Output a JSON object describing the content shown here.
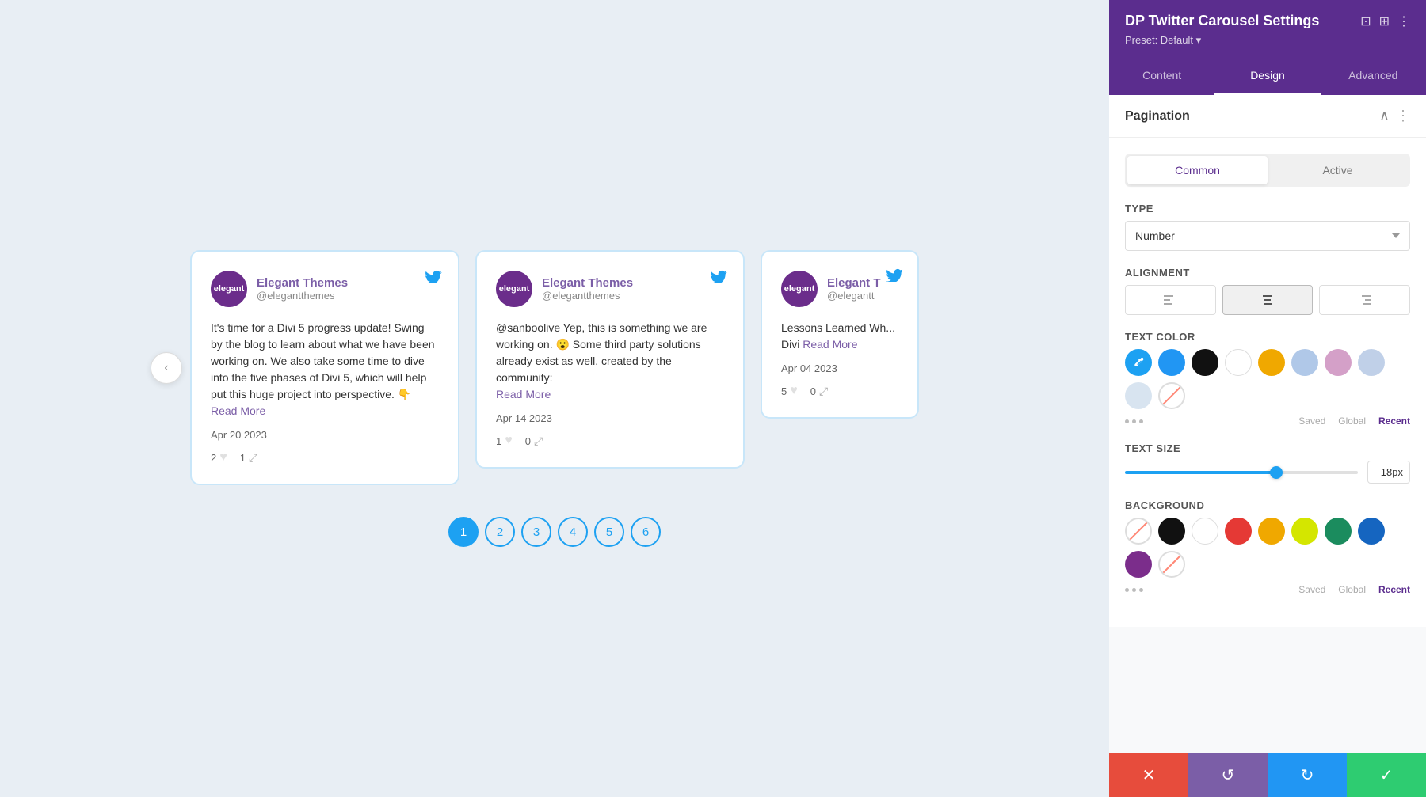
{
  "panel": {
    "title": "DP Twitter Carousel Settings",
    "preset_label": "Preset: Default",
    "preset_arrow": "▾",
    "tabs": [
      {
        "label": "Content",
        "active": false
      },
      {
        "label": "Design",
        "active": true
      },
      {
        "label": "Advanced",
        "active": false
      }
    ],
    "section": {
      "title": "Pagination",
      "sub_tabs": [
        {
          "label": "Common",
          "active": true
        },
        {
          "label": "Active",
          "active": false
        }
      ],
      "type_label": "Type",
      "type_value": "Number",
      "alignment_label": "Alignment",
      "text_color_label": "Text Color",
      "text_size_label": "Text Size",
      "text_size_value": "18px",
      "text_size_percent": 65,
      "background_label": "Background",
      "colors": {
        "text": [
          {
            "color": "#1da1f2",
            "type": "eyedropper"
          },
          {
            "color": "#2196f3"
          },
          {
            "color": "#111111"
          },
          {
            "color": "#ffffff"
          },
          {
            "color": "#f0a800"
          },
          {
            "color": "#b0c8e8"
          },
          {
            "color": "#d4a0c8"
          },
          {
            "color": "#c0d0e8"
          },
          {
            "color": "#d8e4f0"
          },
          {
            "color": "strikethrough"
          }
        ],
        "text_labels": [
          "Saved",
          "Global",
          "Recent"
        ],
        "bg": [
          {
            "color": "strikethrough"
          },
          {
            "color": "#111111"
          },
          {
            "color": "#ffffff"
          },
          {
            "color": "#e53935"
          },
          {
            "color": "#f0a800"
          },
          {
            "color": "#d4e600"
          },
          {
            "color": "#1b8c5e"
          },
          {
            "color": "#1565c0"
          },
          {
            "color": "#7b2d8b"
          },
          {
            "color": "strikethrough"
          }
        ],
        "bg_labels": [
          "Saved",
          "Global",
          "Recent"
        ]
      }
    }
  },
  "tweets": [
    {
      "author": "Elegant Themes",
      "handle": "@elegantthemes",
      "text": "It's time for a Divi 5 progress update! Swing by the blog to learn about what we have been working on. We also take some time to dive into the five phases of Divi 5, which will help put this huge project into perspective. 👇",
      "read_more": "Read More",
      "date": "Apr 20 2023",
      "likes": "2",
      "shares": "1"
    },
    {
      "author": "Elegant Themes",
      "handle": "@elegantthemes",
      "text": "@sanboolive Yep, this is something we are working on. 😮 Some third party solutions already exist as well, created by the community:",
      "read_more": "Read More",
      "date": "Apr 14 2023",
      "likes": "1",
      "shares": "0"
    },
    {
      "author": "Elegant T",
      "handle": "@elegantt",
      "text": "Lessons Learned Wh... Divi",
      "read_more": "Read More",
      "date": "Apr 04 2023",
      "likes": "5",
      "shares": "0"
    }
  ],
  "pagination": {
    "pages": [
      "1",
      "2",
      "3",
      "4",
      "5",
      "6"
    ],
    "active_page": "1"
  },
  "toolbar": {
    "cancel_icon": "✕",
    "undo_icon": "↺",
    "redo_icon": "↻",
    "confirm_icon": "✓"
  }
}
